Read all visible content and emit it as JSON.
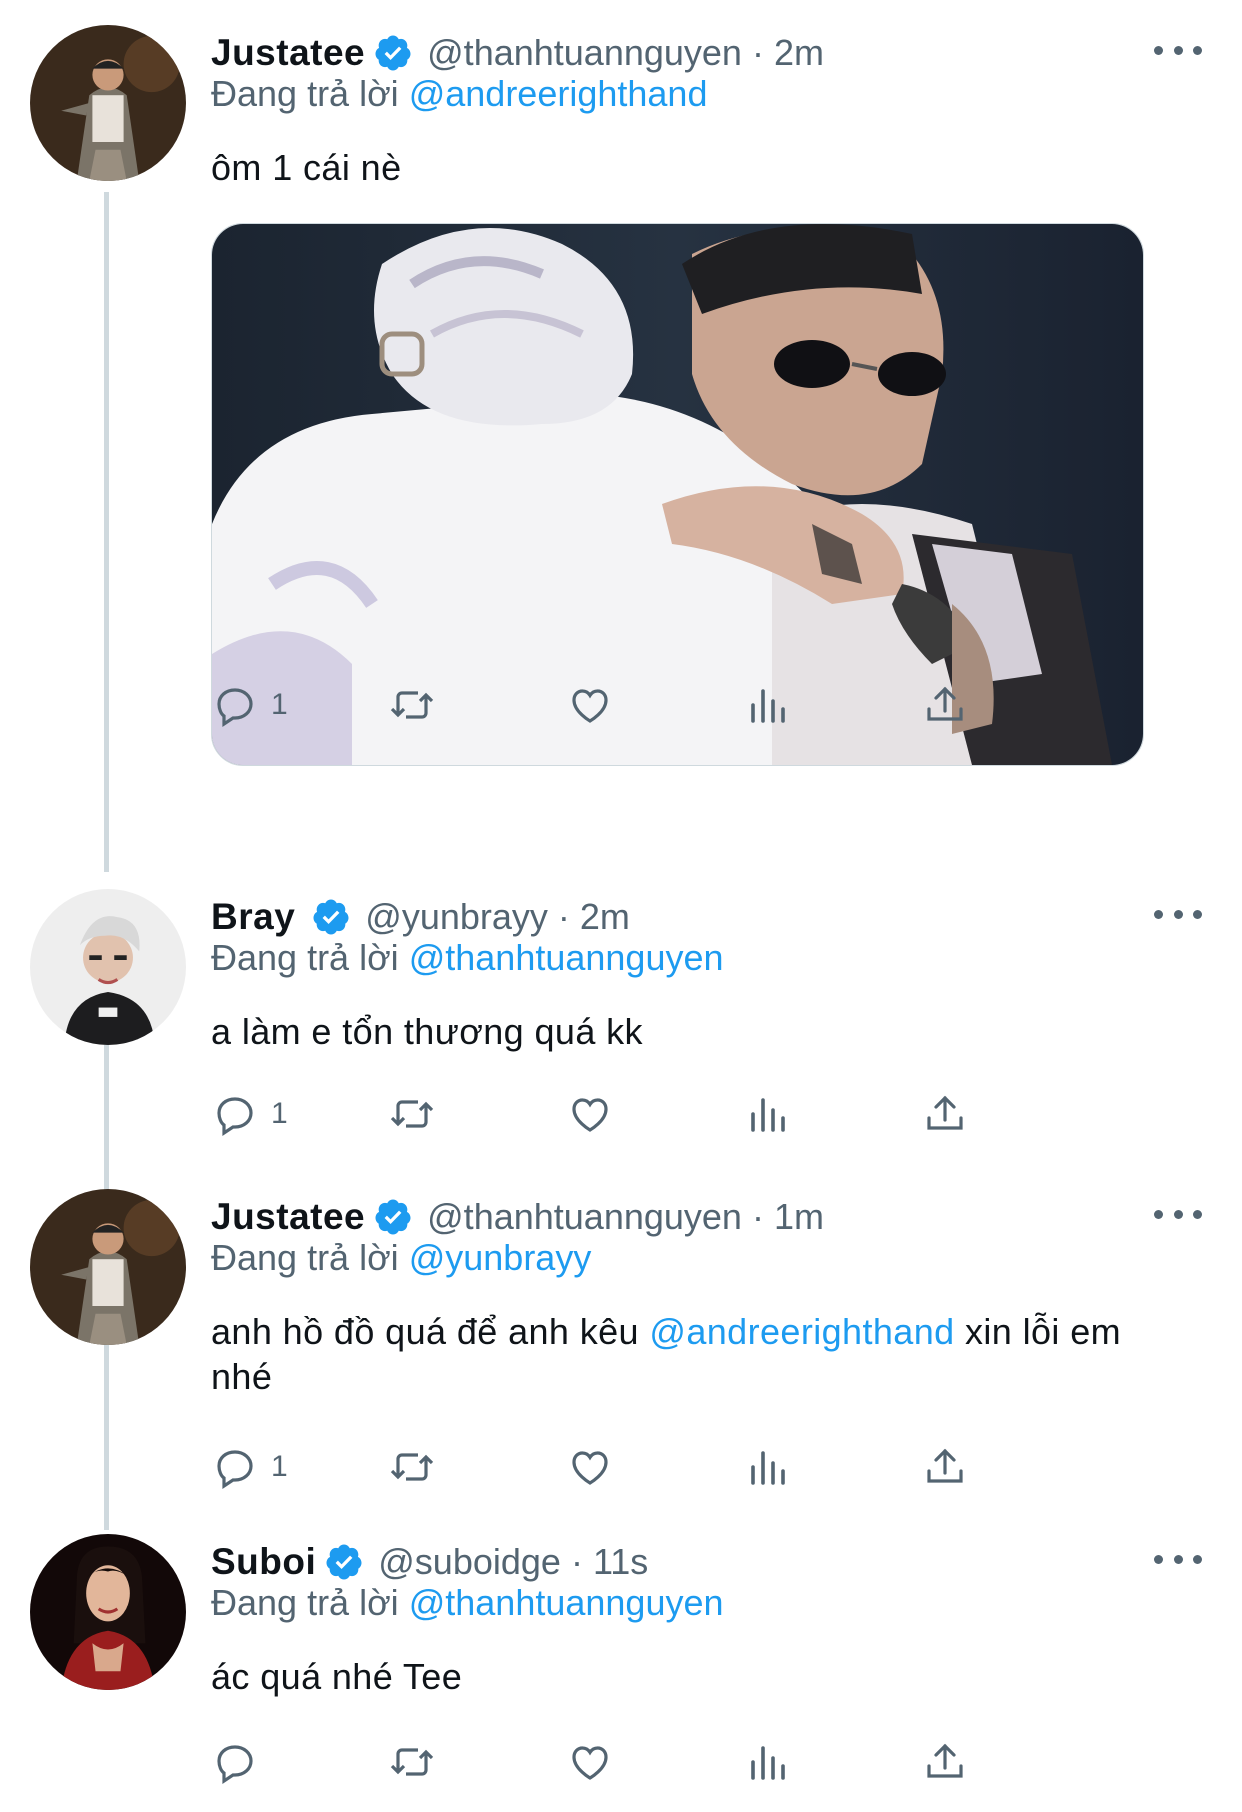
{
  "accent_color": "#1d9bf0",
  "reply_prefix": "Đang trả lời",
  "tweets": [
    {
      "name": "Justatee",
      "handle": "@thanhtuannguyen",
      "separator": "·",
      "time": "2m",
      "reply_to": "@andreerighthand",
      "text": "ôm 1 cái nè",
      "has_media": true,
      "reply_count": "1"
    },
    {
      "name": "Bray",
      "handle": "@yunbrayy",
      "separator": "·",
      "time": "2m",
      "reply_to": "@thanhtuannguyen",
      "text": "a làm e tổn thương quá kk",
      "reply_count": "1"
    },
    {
      "name": "Justatee",
      "handle": "@thanhtuannguyen",
      "separator": "·",
      "time": "1m",
      "reply_to": "@yunbrayy",
      "text_before": "anh hồ đồ quá để anh kêu ",
      "text_mention": "@andreerighthand",
      "text_after": " xin lỗi em nhé",
      "reply_count": "1"
    },
    {
      "name": "Suboi",
      "handle": "@suboidge",
      "separator": "·",
      "time": "11s",
      "reply_to": "@thanhtuannguyen",
      "text": "ác quá nhé Tee",
      "reply_count": ""
    }
  ],
  "icons": [
    "verified-badge-icon",
    "more-icon",
    "reply-icon",
    "retweet-icon",
    "like-icon",
    "views-icon",
    "share-icon"
  ]
}
